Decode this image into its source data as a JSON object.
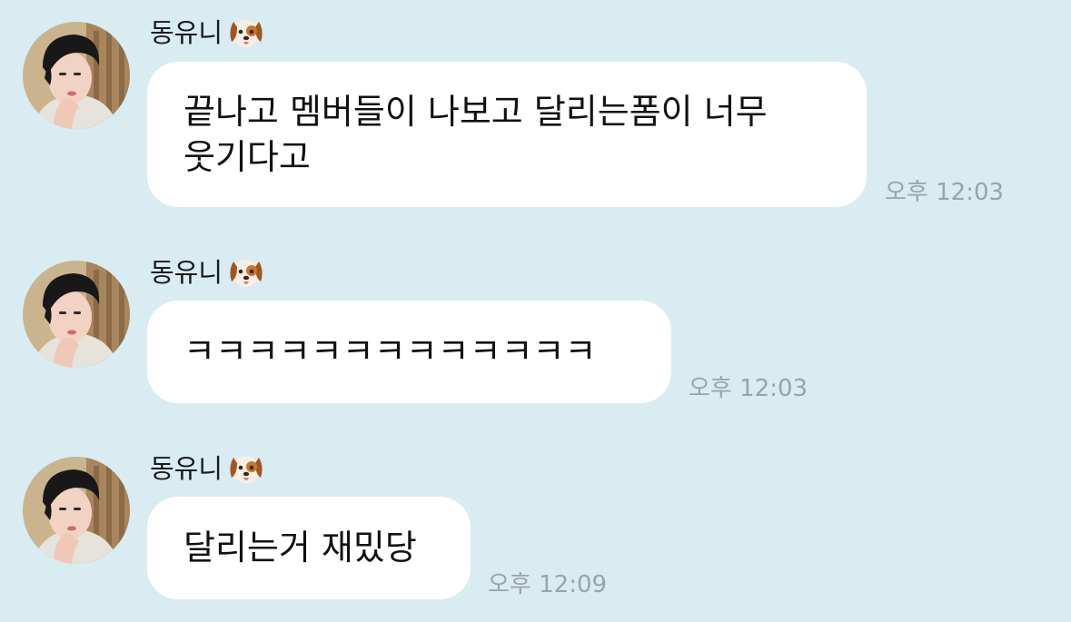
{
  "messages": [
    {
      "sender": "동유니",
      "sender_emoji": "dog-face-icon",
      "text": "끝나고 멤버들이 나보고 달리는폼이 너무\n웃기다고",
      "time": "오후 12:03"
    },
    {
      "sender": "동유니",
      "sender_emoji": "dog-face-icon",
      "text": "ㅋㅋㅋㅋㅋㅋㅋㅋㅋㅋㅋㅋㅋ",
      "time": "오후 12:03"
    },
    {
      "sender": "동유니",
      "sender_emoji": "dog-face-icon",
      "text": "달리는거 재밌당",
      "time": "오후 12:09"
    }
  ],
  "colors": {
    "background": "#d8ecf2",
    "bubble": "#ffffff",
    "timestamp": "#9aa4a8",
    "text": "#111111"
  }
}
